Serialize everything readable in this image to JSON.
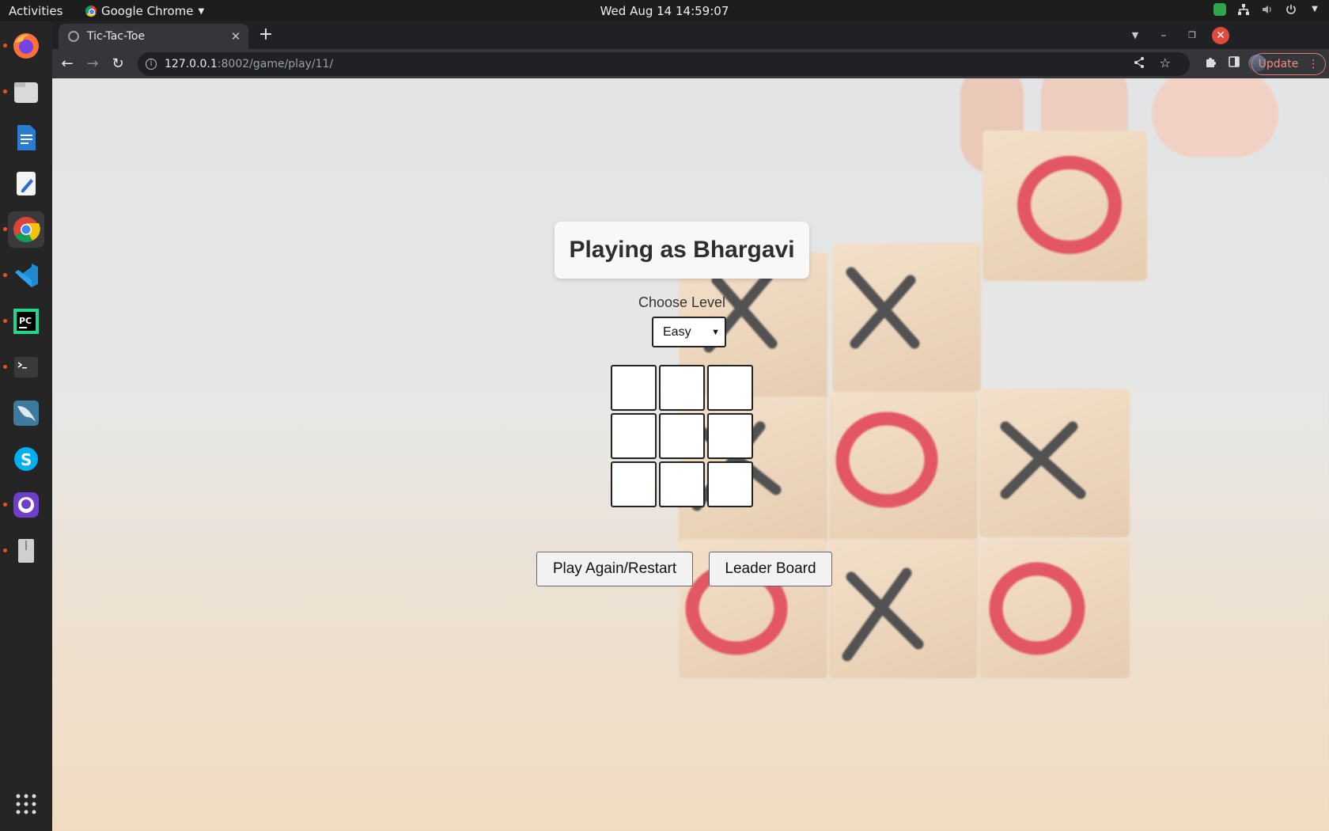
{
  "topbar": {
    "activities": "Activities",
    "app_name": "Google Chrome",
    "clock": "Wed Aug 14  14:59:07"
  },
  "dock": {
    "items": [
      {
        "name": "firefox-icon",
        "color": "#ff7139"
      },
      {
        "name": "files-icon",
        "color": "#d9d9d9"
      },
      {
        "name": "writer-icon",
        "color": "#2a7cd0"
      },
      {
        "name": "text-editor-icon",
        "color": "#f3f3f3"
      },
      {
        "name": "chrome-icon",
        "color": "#4285f4"
      },
      {
        "name": "vscode-icon",
        "color": "#1f8ad2"
      },
      {
        "name": "pycharm-icon",
        "color": "#21d789"
      },
      {
        "name": "terminal-icon",
        "color": "#3a3a3a"
      },
      {
        "name": "mysql-workbench-icon",
        "color": "#3e7a9f"
      },
      {
        "name": "skype-icon",
        "color": "#00aff0"
      },
      {
        "name": "github-icon",
        "color": "#6e40c9"
      },
      {
        "name": "archive-icon",
        "color": "#cfcfcf"
      }
    ]
  },
  "browser": {
    "tab_title": "Tic-Tac-Toe",
    "url_host": "127.0.0.1",
    "url_rest": ":8002/game/play/11/",
    "update_label": "Update"
  },
  "game": {
    "title": "Playing as Bhargavi",
    "level_label": "Choose Level",
    "level_selected": "Easy",
    "board": [
      "",
      "",
      "",
      "",
      "",
      "",
      "",
      "",
      ""
    ],
    "restart_label": "Play Again/Restart",
    "leaderboard_label": "Leader Board"
  },
  "colors": {
    "accent_red": "#e0404f",
    "mark_dark": "#3b3b3b"
  }
}
